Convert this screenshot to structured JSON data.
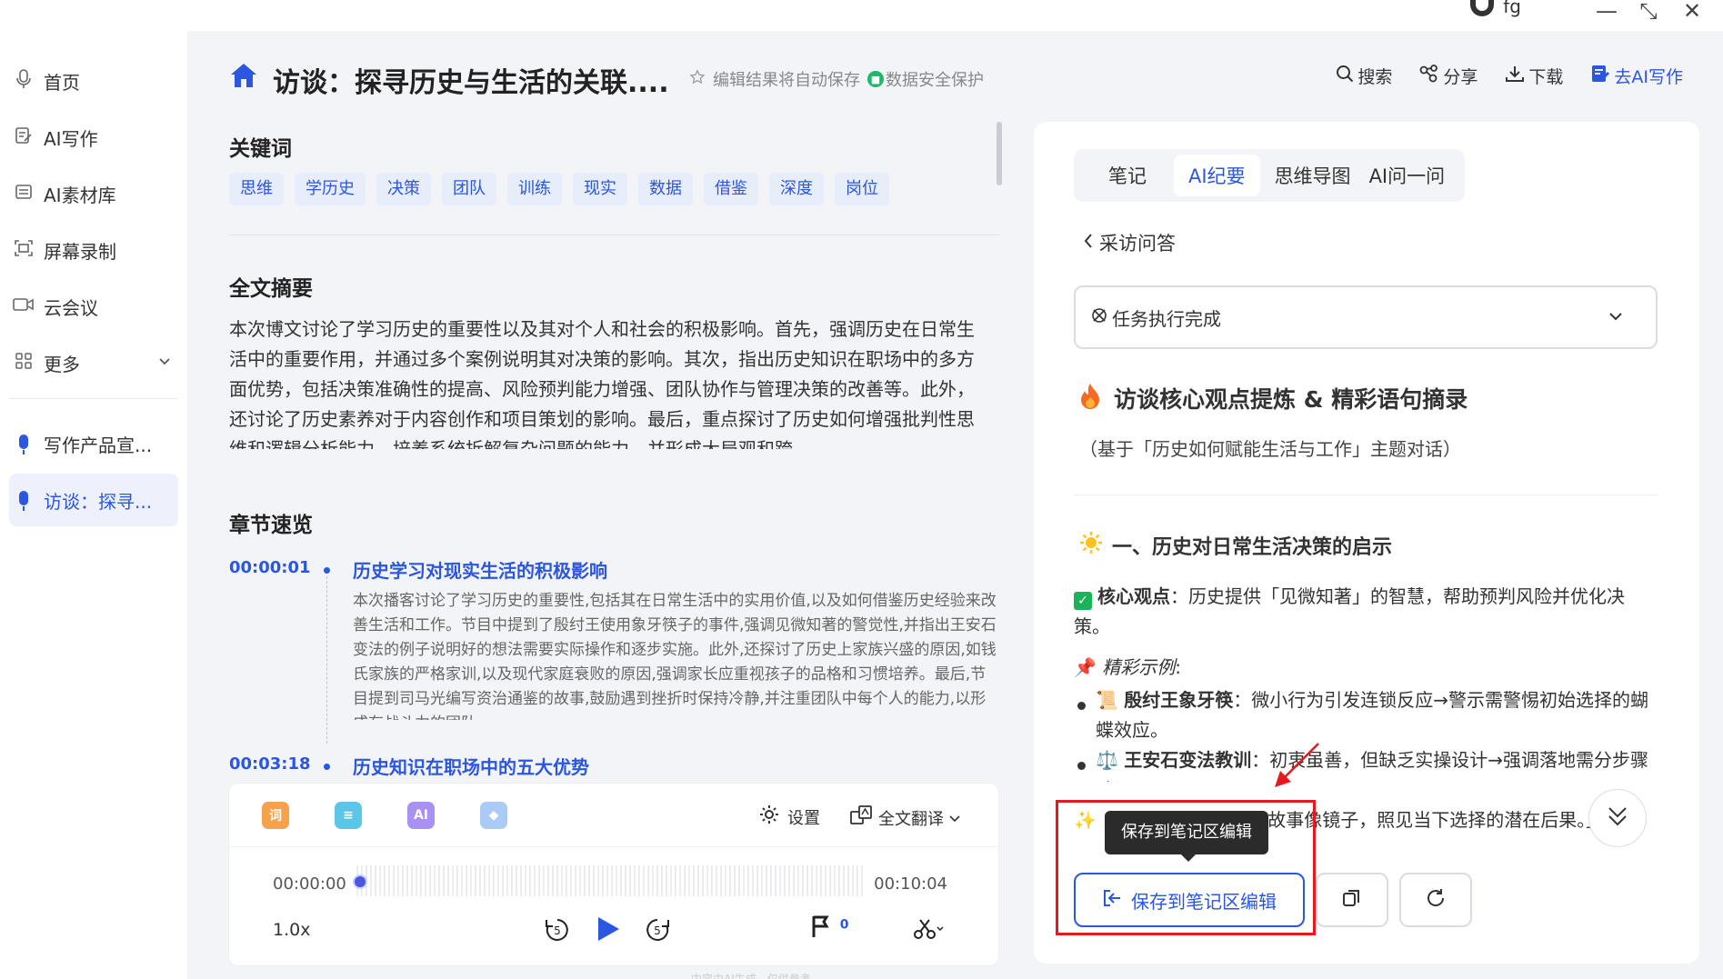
{
  "window": {
    "user_name": "fg",
    "minimize_glyph": "—",
    "restore_glyph": "⤡",
    "close_glyph": "✕"
  },
  "sidebar": {
    "items": [
      {
        "label": "首页",
        "icon": "mic-outline-icon"
      },
      {
        "label": "AI写作",
        "icon": "edit-doc-icon"
      },
      {
        "label": "AI素材库",
        "icon": "library-icon"
      },
      {
        "label": "屏幕录制",
        "icon": "screen-record-icon"
      },
      {
        "label": "云会议",
        "icon": "video-icon"
      },
      {
        "label": "更多",
        "icon": "grid-icon"
      }
    ],
    "recent": [
      {
        "label": "写作产品宣...",
        "icon": "mic-icon"
      },
      {
        "label": "访谈：探寻...",
        "icon": "mic-icon",
        "active": true
      }
    ]
  },
  "header": {
    "title": "访谈：探寻历史与生活的关联....",
    "autosave": "编辑结果将自动保存",
    "secure": "数据安全保护",
    "actions": {
      "search": "搜索",
      "share": "分享",
      "download": "下载",
      "ai_write": "去AI写作"
    }
  },
  "keywords": {
    "title": "关键词",
    "items": [
      "思维",
      "学历史",
      "决策",
      "团队",
      "训练",
      "现实",
      "数据",
      "借鉴",
      "深度",
      "岗位"
    ]
  },
  "summary": {
    "title": "全文摘要",
    "text": "本次博文讨论了学习历史的重要性以及其对个人和社会的积极影响。首先，强调历史在日常生活中的重要作用，并通过多个案例说明其对决策的影响。其次，指出历史知识在职场中的多方面优势，包括决策准确性的提高、风险预判能力增强、团队协作与管理决策的改善等。此外，还讨论了历史素养对于内容创作和项目策划的影响。最后，重点探讨了历史如何增强批判性思维和逻辑分析能力，培养系统拆解复杂问题的能力，并形成大局观和跨"
  },
  "chapters": {
    "title": "章节速览",
    "items": [
      {
        "time": "00:00:01",
        "title": "历史学习对现实生活的积极影响",
        "body": "本次播客讨论了学习历史的重要性,包括其在日常生活中的实用价值,以及如何借鉴历史经验来改善生活和工作。节目中提到了殷纣王使用象牙筷子的事件,强调见微知著的警觉性,并指出王安石变法的例子说明好的想法需要实际操作和逐步实施。此外,还探讨了历史上家族兴盛的原因,如钱氏家族的严格家训,以及现代家庭衰败的原因,强调家长应重视孩子的品格和习惯培养。最后,节目提到司马光编写资治通鉴的故事,鼓励遇到挫折时保持冷静,并注重团队中每个人的能力,以形成有战斗力的团队。"
      },
      {
        "time": "00:03:18",
        "title": "历史知识在职场中的五大优势",
        "body": ""
      }
    ]
  },
  "player": {
    "tools": [
      {
        "label": "词",
        "icon": "word-tool-icon",
        "color": "#f7a14a"
      },
      {
        "label": "≡",
        "icon": "outline-tool-icon",
        "color": "#5cc6e8"
      },
      {
        "label": "AI",
        "icon": "ai-tool-icon",
        "color": "#a891f2"
      },
      {
        "label": "◆",
        "icon": "cloud-tool-icon",
        "color": "#a9cbf5"
      }
    ],
    "settings": "设置",
    "translate": "全文翻译",
    "time_start": "00:00:00",
    "time_end": "00:10:04",
    "progress": 0.0,
    "speed": "1.0x",
    "skip_back": "5",
    "skip_forward": "5",
    "flag_count": "0"
  },
  "panel": {
    "tabs": [
      "笔记",
      "AI纪要",
      "思维导图",
      "AI问一问"
    ],
    "active_tab": "AI纪要",
    "back_label": "采访问答",
    "task_status": "任务执行完成",
    "title": "访谈核心观点提炼 & 精彩语句摘录",
    "subtitle": "（基于「历史如何赋能生活与工作」主题对话）",
    "section1_title": "一、历史对日常生活决策的启示",
    "core_label": "核心观点",
    "core_text": "：历史提供「见微知著」的智慧，帮助预判风险并优化决策。",
    "example_label": "精彩示例",
    "example_colon": ":",
    "bullet1_label": "殷纣王象牙筷",
    "bullet1_text": "：微小行为引发连锁反应→警示需警惕初始选择的蝴蝶效应。",
    "bullet2_label": "王安石变法教训",
    "bullet2_text": "：初衷虽善，但缺乏实操设计→强调落地需分步骤验证。",
    "quote_text": "故事像镜子，照见当下选择的潜在后果。」",
    "save_button": "保存到笔记区编辑",
    "tooltip": "保存到笔记区编辑"
  },
  "footer_note": "内容由AI生成，仅供参考"
}
